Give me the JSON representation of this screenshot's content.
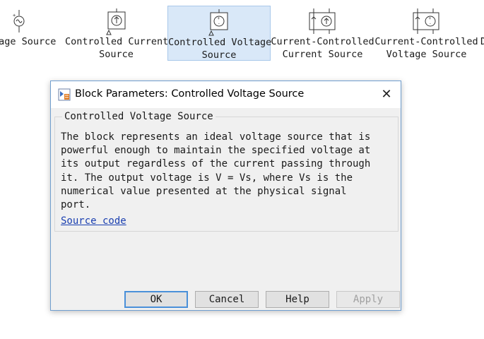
{
  "palette": {
    "blocks": [
      {
        "label": "tage Source",
        "selected": false,
        "icon": "ac-voltage-source-icon"
      },
      {
        "label": "Controlled Current\nSource",
        "selected": false,
        "icon": "controlled-current-source-icon"
      },
      {
        "label": "Controlled Voltage\nSource",
        "selected": true,
        "icon": "controlled-voltage-source-icon"
      },
      {
        "label": "Current-Controlled\nCurrent Source",
        "selected": false,
        "icon": "current-controlled-current-source-icon"
      },
      {
        "label": "Current-Controlled\nVoltage Source",
        "selected": false,
        "icon": "current-controlled-voltage-source-icon"
      },
      {
        "label": "D",
        "selected": false,
        "icon": ""
      }
    ]
  },
  "dialog": {
    "title": "Block Parameters: Controlled Voltage Source",
    "close_glyph": "✕",
    "group_title": "Controlled Voltage Source",
    "description": "The block represents an ideal voltage source that is\npowerful enough to maintain the specified voltage at\nits output regardless of the current passing through\nit. The output voltage is V = Vs, where Vs is the\nnumerical value presented at the physical signal\nport.",
    "source_link": "Source code",
    "buttons": {
      "ok": "OK",
      "cancel": "Cancel",
      "help": "Help",
      "apply": "Apply"
    }
  }
}
